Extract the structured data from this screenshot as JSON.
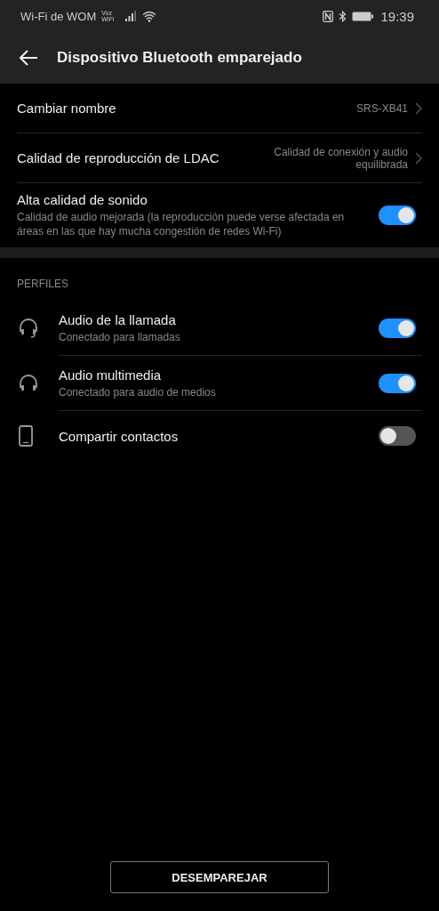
{
  "status_bar": {
    "carrier": "Wi-Fi de WOM",
    "voz": "Voz",
    "wifi_label": "WiFi",
    "time": "19:39"
  },
  "header": {
    "title": "Dispositivo Bluetooth emparejado"
  },
  "settings": [
    {
      "kind": "link",
      "label": "Cambiar nombre",
      "value": "SRS-XB41"
    },
    {
      "kind": "link",
      "label": "Calidad de reproducción de LDAC",
      "value": "Calidad de conexión y audio equilibrada"
    },
    {
      "kind": "switch",
      "label": "Alta calidad de sonido",
      "description": "Calidad de audio mejorada (la reproducción puede verse afectada en áreas en las que hay mucha congestión de redes Wi-Fi)",
      "on": true
    }
  ],
  "profiles": {
    "heading": "PERFILES",
    "items": [
      {
        "kind": "headset",
        "label": "Audio de la llamada",
        "description": "Conectado para llamadas",
        "on": true
      },
      {
        "kind": "headphones",
        "label": "Audio multimedia",
        "description": "Conectado para audio de medios",
        "on": true
      },
      {
        "kind": "phone",
        "label": "Compartir contactos",
        "on": false
      }
    ]
  },
  "unpair_button": "DESEMPAREJAR"
}
